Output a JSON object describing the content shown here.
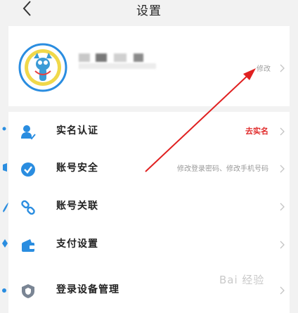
{
  "header": {
    "title": "设置",
    "back_icon": "chevron-left-icon"
  },
  "profile": {
    "edit_label": "修改"
  },
  "menu": {
    "items": [
      {
        "label": "实名认证",
        "value": "去实名",
        "icon": "person-icon",
        "value_color": "#e02a2a"
      },
      {
        "label": "账号安全",
        "value": "修改登录密码、修改手机号码",
        "icon": "shield-check-icon"
      },
      {
        "label": "账号关联",
        "value": "",
        "icon": "link-icon"
      },
      {
        "label": "支付设置",
        "value": "",
        "icon": "wallet-icon"
      },
      {
        "label": "登录设备管理",
        "value": "",
        "icon": "shield-icon"
      }
    ]
  },
  "left_strip": {
    "icons": [
      "blue-dot-icon",
      "blue-flag-icon",
      "blue-feather-icon",
      "blue-pin-icon",
      "blue-wing-icon"
    ]
  },
  "watermark": {
    "text": "Bai  经验"
  },
  "colors": {
    "accent": "#2a8de0",
    "annotation": "#e02020",
    "alert": "#e02a2a"
  }
}
